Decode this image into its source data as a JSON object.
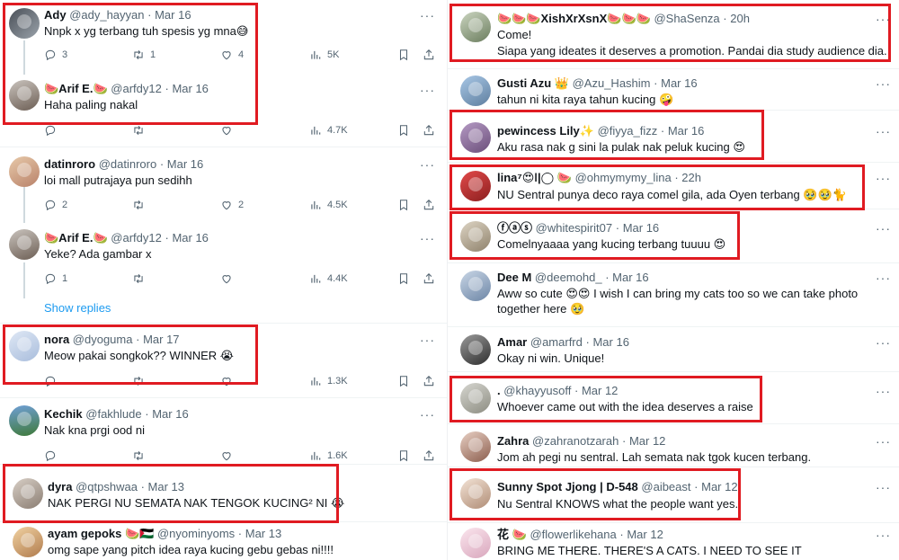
{
  "left": {
    "t1": {
      "name": "Ady",
      "handle": "@ady_hayyan",
      "date": "Mar 16",
      "text": "Nnpk x yg terbang tuh spesis yg mna😅",
      "replies": "3",
      "retweets": "1",
      "likes": "4",
      "views": "5K"
    },
    "t2": {
      "name": "🍉Arif E.🍉",
      "handle": "@arfdy12",
      "date": "Mar 16",
      "text": "Haha paling nakal",
      "views": "4.7K"
    },
    "t3": {
      "name": "datinroro",
      "handle": "@datinroro",
      "date": "Mar 16",
      "text": "loi mall putrajaya pun sedihh",
      "replies": "2",
      "likes": "2",
      "views": "4.5K"
    },
    "t4": {
      "name": "🍉Arif E.🍉",
      "handle": "@arfdy12",
      "date": "Mar 16",
      "text": "Yeke? Ada gambar x",
      "replies": "1",
      "views": "4.4K"
    },
    "show_replies": "Show replies",
    "t5": {
      "name": "nora",
      "handle": "@dyoguma",
      "date": "Mar 17",
      "text": "Meow pakai songkok?? WINNER 😭",
      "views": "1.3K"
    },
    "t6": {
      "name": "Kechik",
      "handle": "@fakhlude",
      "date": "Mar 16",
      "text": "Nak kna prgi ood ni",
      "views": "1.6K"
    },
    "t7": {
      "name": "dyra",
      "handle": "@qtpshwaa",
      "date": "Mar 13",
      "text": "NAK PERGI NU SEMATA NAK TENGOK KUCING² NI 😭"
    },
    "t8": {
      "name": "ayam gepoks 🍉🇵🇸",
      "handle": "@nyominyoms",
      "date": "Mar 13",
      "text": "omg sape yang pitch idea raya kucing gebu gebas ni!!!!"
    }
  },
  "right": {
    "r1": {
      "name": "🍉🍉🍉XishXrXsnX🍉🍉🍉",
      "handle": "@ShaSenza",
      "date": "20h",
      "text1": "Come!",
      "text2": "Siapa yang ideates it deserves a promotion.  Pandai dia study audience dia."
    },
    "r2": {
      "name": "Gusti Azu 👑",
      "handle": "@Azu_Hashim",
      "date": "Mar 16",
      "text": "tahun ni kita raya tahun kucing 🤪"
    },
    "r3": {
      "name": "pewincess Lily✨",
      "handle": "@fiyya_fizz",
      "date": "Mar 16",
      "text": "Aku rasa nak g sini la pulak nak peluk kucing 😍"
    },
    "r4": {
      "name": "lina⁷😍ǀ|◯ 🍉",
      "handle": "@ohmymymy_lina",
      "date": "22h",
      "text": "NU Sentral punya deco raya comel gila, ada Oyen terbang 🥹🥹🐈"
    },
    "r5": {
      "name": "ⓕⓐⓢ",
      "handle": "@whitespirit07",
      "date": "Mar 16",
      "text": "Comelnyaaaa yang kucing terbang tuuuu 😍"
    },
    "r6": {
      "name": "Dee M",
      "handle": "@deemohd_",
      "date": "Mar 16",
      "text1": "Aww so cute 😍😍 I wish I can bring my cats too so we can take photo",
      "text2": "together here 🥹"
    },
    "r7": {
      "name": "Amar",
      "handle": "@amarfrd",
      "date": "Mar 16",
      "text": "Okay ni win. Unique!"
    },
    "r8": {
      "name": ".",
      "handle": "@khayyusoff",
      "date": "Mar 12",
      "text": "Whoever came out with the idea deserves a raise"
    },
    "r9": {
      "name": "Zahra",
      "handle": "@zahranotzarah",
      "date": "Mar 12",
      "text": "Jom ah pegi nu sentral. Lah semata nak tgok kucen terbang."
    },
    "r10": {
      "name": "Sunny Spot Jjong | D-548",
      "handle": "@aibeast",
      "date": "Mar 12",
      "text": "Nu Sentral KNOWS what the people want yes."
    },
    "r11": {
      "name": "花 🍉",
      "handle": "@flowerlikehana",
      "date": "Mar 12",
      "text": "BRING ME THERE. THERE'S A CATS. I NEED TO SEE IT"
    }
  },
  "more_glyph": "···",
  "colors": {
    "highlight": "#e01b22",
    "link": "#1d9bf0",
    "muted": "#536471"
  }
}
